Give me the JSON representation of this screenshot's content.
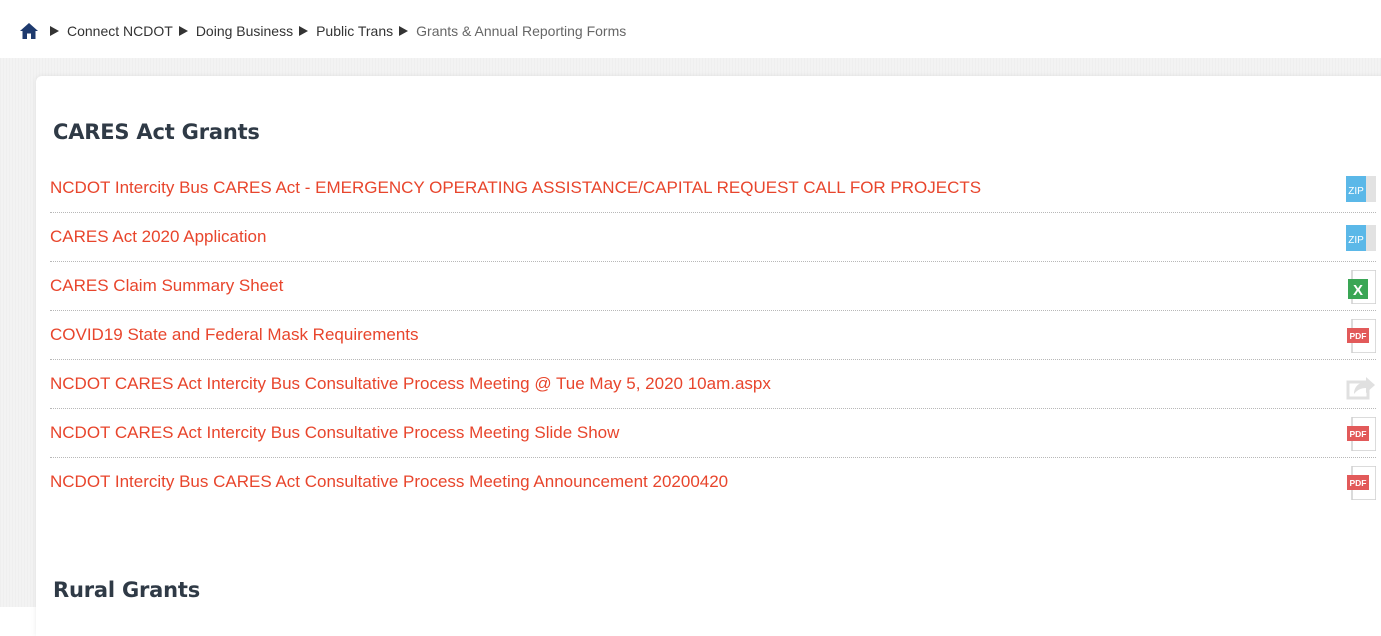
{
  "breadcrumb": {
    "items": [
      {
        "label": "Connect NCDOT"
      },
      {
        "label": "Doing Business"
      },
      {
        "label": "Public Trans"
      }
    ],
    "current": "Grants & Annual Reporting Forms"
  },
  "sections": [
    {
      "title": "CARES Act Grants",
      "items": [
        {
          "label": "NCDOT Intercity Bus CARES Act - EMERGENCY OPERATING ASSISTANCE/CAPITAL REQUEST CALL FOR PROJECTS",
          "icon": "zip-file-icon",
          "icon_text": "ZIP"
        },
        {
          "label": "CARES Act 2020 Application",
          "icon": "zip-file-icon",
          "icon_text": "ZIP"
        },
        {
          "label": "CARES Claim Summary Sheet",
          "icon": "excel-file-icon",
          "icon_text": "X"
        },
        {
          "label": "COVID19 State and Federal Mask Requirements",
          "icon": "pdf-file-icon",
          "icon_text": "PDF"
        },
        {
          "label": "NCDOT CARES Act Intercity Bus Consultative Process Meeting @ Tue May 5, 2020 10am.aspx",
          "icon": "share-link-icon",
          "icon_text": ""
        },
        {
          "label": "NCDOT CARES Act Intercity Bus Consultative Process Meeting Slide Show",
          "icon": "pdf-file-icon",
          "icon_text": "PDF"
        },
        {
          "label": "NCDOT Intercity Bus CARES Act Consultative Process Meeting Announcement 20200420",
          "icon": "pdf-file-icon",
          "icon_text": "PDF"
        }
      ]
    },
    {
      "title": "Rural Grants",
      "items": []
    }
  ],
  "colors": {
    "link": "#e8452c",
    "zip": "#5bb8e8",
    "excel": "#3aa655",
    "pdf": "#e25a5a"
  }
}
